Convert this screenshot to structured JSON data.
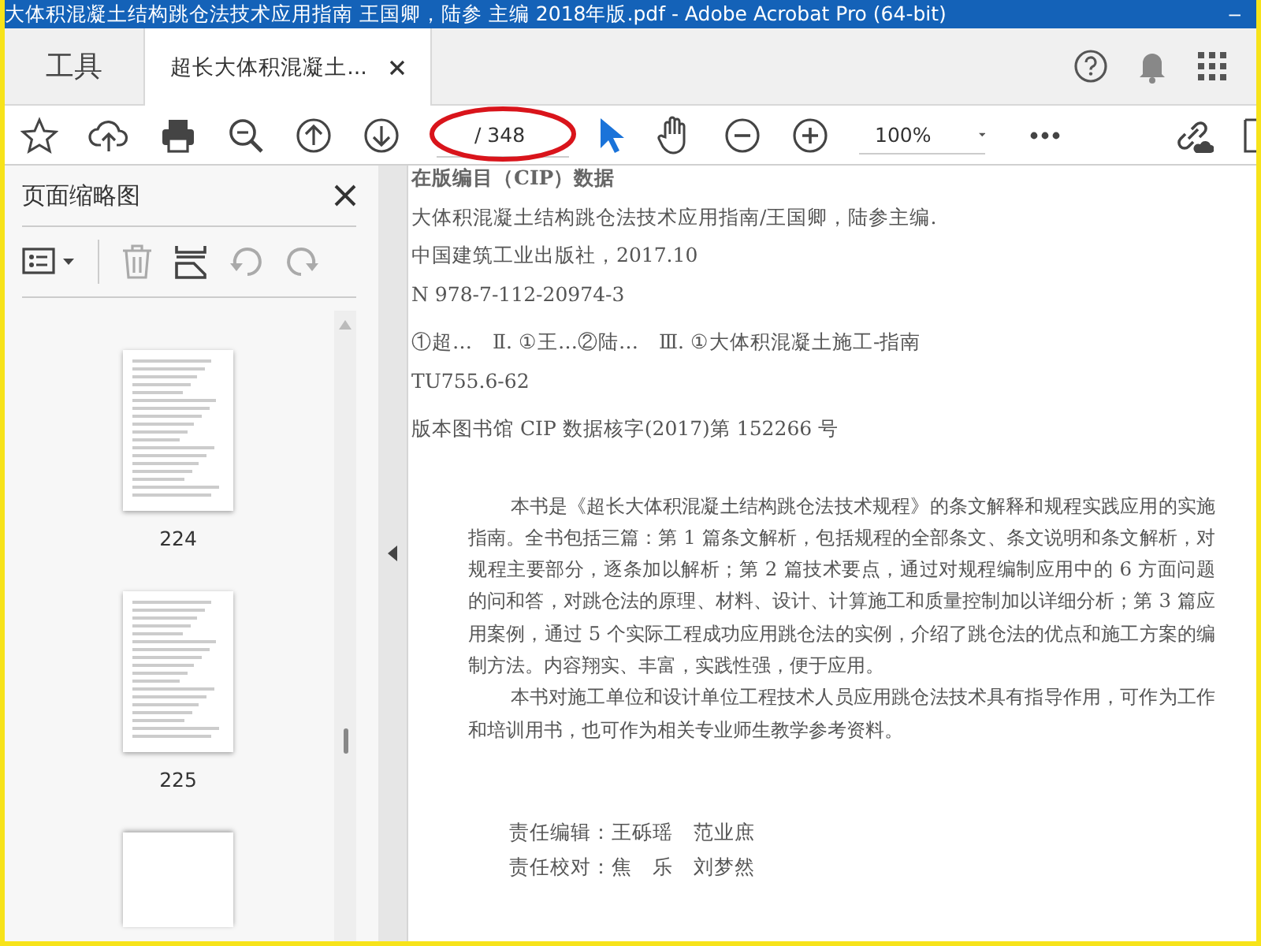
{
  "window": {
    "title": "大体积混凝土结构跳仓法技术应用指南 王国卿，陆参 主编 2018年版.pdf - Adobe Acrobat Pro (64-bit)",
    "minimize": "–"
  },
  "tabs": [
    {
      "label": "工具",
      "selected": false,
      "closable": false
    },
    {
      "label": "超长大体积混凝土...",
      "selected": true,
      "closable": true
    }
  ],
  "toolbar": {
    "page_total": "/ 348",
    "zoom": "100%"
  },
  "thumbnails_panel": {
    "title": "页面缩略图",
    "pages": [
      {
        "label": "224",
        "cut_off": false
      },
      {
        "label": "225",
        "cut_off": false
      },
      {
        "cut_off": true
      }
    ]
  },
  "document": {
    "cip_lines": [
      "在版编目（CIP）数据",
      "大体积混凝土结构跳仓法技术应用指南/王国卿，陆参主编.",
      "中国建筑工业出版社，2017.10",
      "N 978-7-112-20974-3",
      "①超…　Ⅱ. ①王…②陆…　Ⅲ. ①大体积混凝土施工-指南",
      "TU755.6-62",
      "版本图书馆 CIP 数据核字(2017)第 152266 号"
    ],
    "paragraphs": [
      "本书是《超长大体积混凝土结构跳仓法技术规程》的条文解释和规程实践应用的实施指南。全书包括三篇：第 1 篇条文解析，包括规程的全部条文、条文说明和条文解析，对规程主要部分，逐条加以解析；第 2 篇技术要点，通过对规程编制应用中的 6 方面问题的问和答，对跳仓法的原理、材料、设计、计算施工和质量控制加以详细分析；第 3 篇应用案例，通过 5 个实际工程成功应用跳仓法的实例，介绍了跳仓法的优点和施工方案的编制方法。内容翔实、丰富，实践性强，便于应用。",
      "本书对施工单位和设计单位工程技术人员应用跳仓法技术具有指导作用，可作为工作和培训用书，也可作为相关专业师生教学参考资料。"
    ],
    "credits": [
      "责任编辑：王砾瑶　范业庶",
      "责任校对：焦　乐　刘梦然"
    ]
  }
}
